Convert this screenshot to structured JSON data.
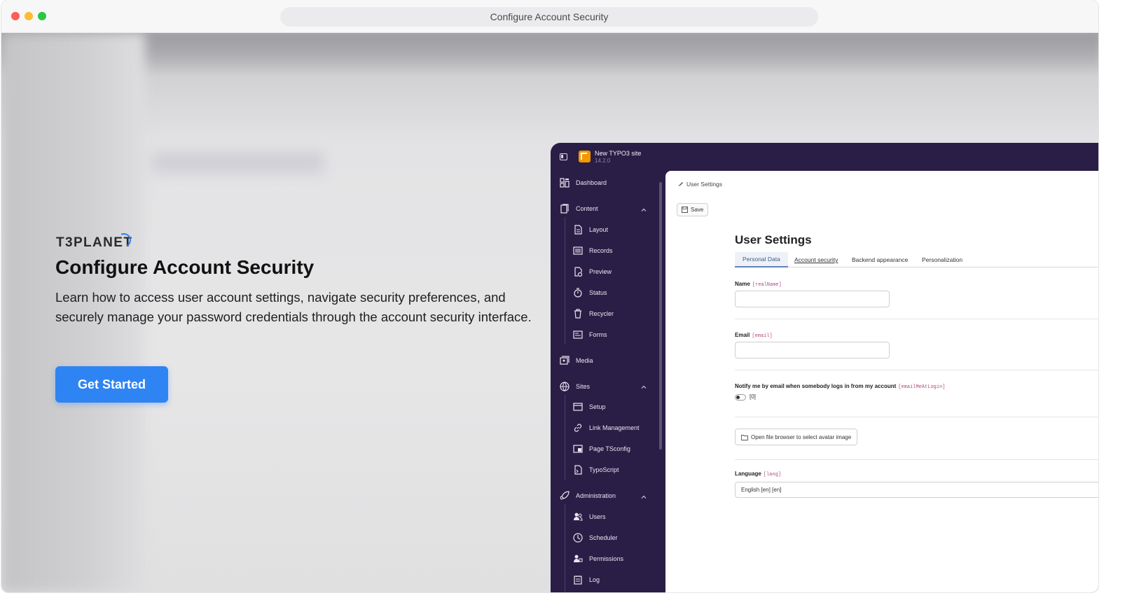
{
  "window": {
    "title": "Configure Account Security"
  },
  "hero": {
    "brand": "T3PLANET",
    "title": "Configure Account Security",
    "description": "Learn how to access user account settings, navigate security preferences, and securely manage your password credentials through the account security interface.",
    "cta_label": "Get Started",
    "cta_color": "#2f84f3"
  },
  "typo3": {
    "site_name": "New TYPO3 site",
    "version": "14.2.0",
    "sidebar": {
      "dashboard": "Dashboard",
      "content": {
        "label": "Content",
        "items": [
          "Layout",
          "Records",
          "Preview",
          "Status",
          "Recycler",
          "Forms"
        ]
      },
      "media": "Media",
      "sites": {
        "label": "Sites",
        "items": [
          "Setup",
          "Link Management",
          "Page TSconfig",
          "TypoScript"
        ]
      },
      "administration": {
        "label": "Administration",
        "items": [
          "Users",
          "Scheduler",
          "Permissions",
          "Log"
        ]
      }
    },
    "main": {
      "breadcrumb": "User Settings",
      "save_label": "Save",
      "heading": "User Settings",
      "tabs": [
        "Personal Data",
        "Account security",
        "Backend appearance",
        "Personalization"
      ],
      "name_label": "Name",
      "name_code": "[realName]",
      "email_label": "Email",
      "email_code": "[email]",
      "notify_label": "Notify me by email when somebody logs in from my account",
      "notify_code": "[emailMeAtLogin]",
      "notify_value": "[0]",
      "avatar_button": "Open file browser to select avatar image",
      "language_label": "Language",
      "language_code": "[lang]",
      "language_value": "English [en] [en]"
    },
    "colors": {
      "sidebar_bg": "#2a1e46",
      "accent": "#f49700"
    }
  }
}
